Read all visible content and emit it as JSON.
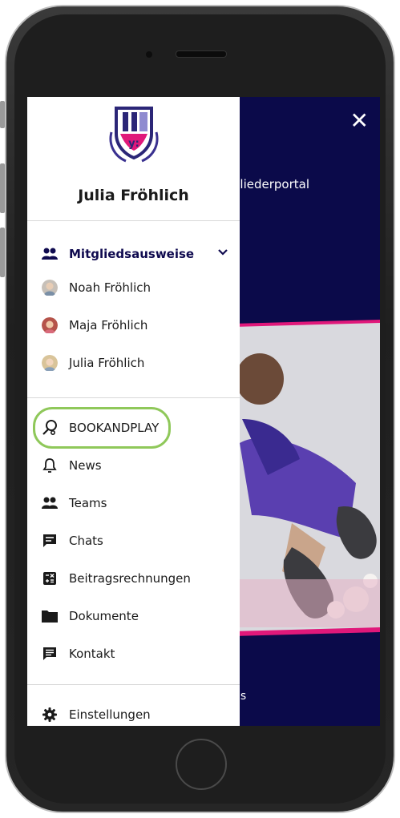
{
  "app": {
    "background_title": "tgliederportal",
    "background_footer": "is",
    "close_icon": "close-icon"
  },
  "drawer": {
    "user_name": "Julia Fröhlich",
    "membership": {
      "label": "Mitgliedsausweise",
      "icon": "people-icon",
      "expanded": true,
      "members": [
        {
          "name": "Noah Fröhlich"
        },
        {
          "name": "Maja Fröhlich"
        },
        {
          "name": "Julia Fröhlich"
        }
      ]
    },
    "menu": [
      {
        "label": "BOOKANDPLAY",
        "icon": "racket-icon",
        "highlighted": true
      },
      {
        "label": "News",
        "icon": "bell-icon"
      },
      {
        "label": "Teams",
        "icon": "people-icon"
      },
      {
        "label": "Chats",
        "icon": "chat-icon"
      },
      {
        "label": "Beitragsrechnungen",
        "icon": "calculator-icon"
      },
      {
        "label": "Dokumente",
        "icon": "folder-icon"
      },
      {
        "label": "Kontakt",
        "icon": "message-icon"
      }
    ],
    "settings": {
      "label": "Einstellungen",
      "icon": "gear-icon"
    }
  },
  "colors": {
    "navy": "#0b0a4a",
    "pink": "#e0187a",
    "highlight_green": "#8fc85a"
  }
}
